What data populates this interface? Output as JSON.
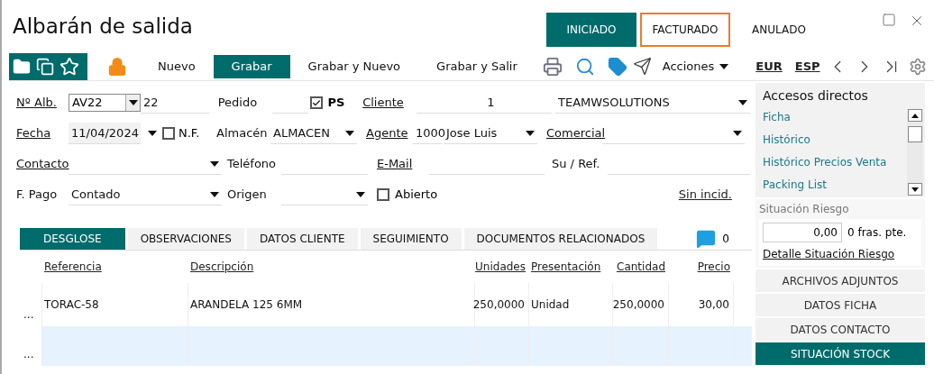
{
  "window": {
    "title": "Albarán de salida"
  },
  "status_tabs": [
    {
      "label": "INICIADO",
      "selected": true,
      "focused": false
    },
    {
      "label": "FACTURADO",
      "selected": false,
      "focused": true
    },
    {
      "label": "ANULADO",
      "selected": false,
      "focused": false
    }
  ],
  "toolbar": {
    "buttons": [
      {
        "label": "Nuevo",
        "selected": false
      },
      {
        "label": "Grabar",
        "selected": true
      },
      {
        "label": "Grabar y Nuevo",
        "selected": false
      },
      {
        "label": "Grabar y Salir",
        "selected": false
      }
    ],
    "actions": "Acciones",
    "currency": "EUR",
    "language": "ESP"
  },
  "form": {
    "albaran": {
      "label": "Nº Alb.",
      "series": "AV22",
      "number": "22"
    },
    "pedido": {
      "label": "Pedido",
      "ps_checked": true,
      "ps_label": "PS"
    },
    "cliente": {
      "label": "Cliente",
      "code": "1",
      "name": "TEAMWSOLUTIONS"
    },
    "fecha": {
      "label": "Fecha",
      "value": "11/04/2024",
      "nf_checked": false,
      "nf_label": "N.F."
    },
    "almacen": {
      "label": "Almacén",
      "value": "ALMACEN"
    },
    "agente": {
      "label": "Agente",
      "code": "1000",
      "name": "Jose Luis"
    },
    "comercial": {
      "label": "Comercial"
    },
    "contacto": {
      "label": "Contacto"
    },
    "telefono": {
      "label": "Teléfono"
    },
    "email": {
      "label": "E-Mail"
    },
    "su_ref": {
      "label": "Su / Ref."
    },
    "forma_pago": {
      "label": "F. Pago",
      "value": "Contado"
    },
    "origen": {
      "label": "Origen"
    },
    "abierto": {
      "label": "Abierto",
      "checked": false
    },
    "incidencias": "Sin incid."
  },
  "detail_tabs": [
    {
      "label": "DESGLOSE",
      "selected": true
    },
    {
      "label": "OBSERVACIONES",
      "selected": false
    },
    {
      "label": "DATOS CLIENTE",
      "selected": false
    },
    {
      "label": "SEGUIMIENTO",
      "selected": false
    },
    {
      "label": "DOCUMENTOS RELACIONADOS",
      "selected": false
    }
  ],
  "comments_count": "0",
  "table": {
    "columns": [
      "Referencia",
      "Descripción",
      "Unidades",
      "Presentación",
      "Cantidad",
      "Precio"
    ],
    "rows": [
      {
        "marker": "...",
        "cells": [
          "TORAC-58",
          "ARANDELA 125 6MM",
          "250,0000",
          "Unidad",
          "250,0000",
          "30,00"
        ],
        "selected": false
      },
      {
        "marker": "...",
        "selected": true
      }
    ]
  },
  "sidebar": {
    "shortcuts_title": "Accesos directos",
    "shortcuts": [
      "Ficha",
      "Histórico",
      "Histórico Precios Venta",
      "Packing List"
    ],
    "risk_title": "Situación Riesgo",
    "risk_amount": "0,00",
    "pending_invoices": "0 fras. pte.",
    "risk_detail_link": "Detalle Situación Riesgo",
    "panels": [
      {
        "label": "ARCHIVOS ADJUNTOS",
        "selected": false
      },
      {
        "label": "DATOS FICHA",
        "selected": false
      },
      {
        "label": "DATOS CONTACTO",
        "selected": false
      },
      {
        "label": "SITUACIÓN STOCK",
        "selected": true
      }
    ]
  }
}
